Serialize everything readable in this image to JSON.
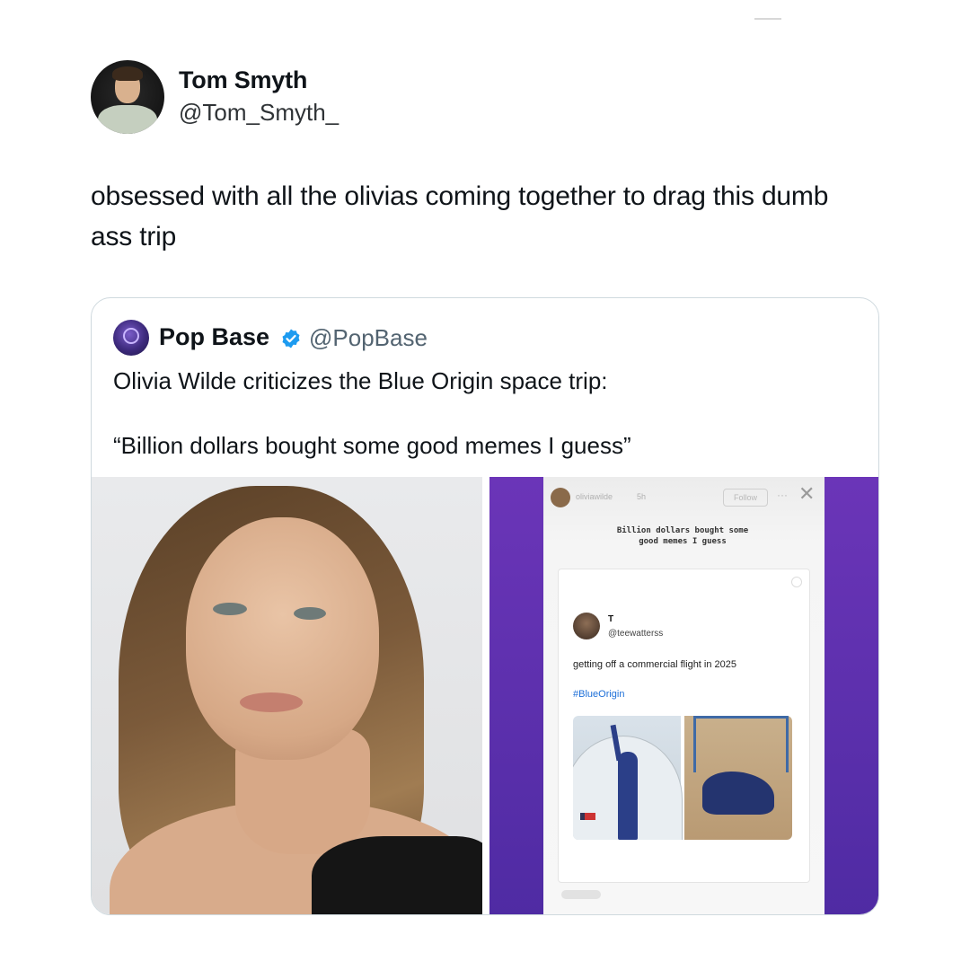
{
  "tweet": {
    "author_name": "Tom Smyth",
    "author_handle": "@Tom_Smyth_",
    "text": "obsessed with all the olivias coming together to drag this dumb ass trip"
  },
  "quote": {
    "author_name": "Pop Base",
    "author_handle": "@PopBase",
    "verified": true,
    "text": "Olivia Wilde criticizes the Blue Origin space trip:\n\n“Billion dollars bought some good memes I guess”"
  },
  "story": {
    "username": "oliviawilde",
    "time": "5h",
    "follow_label": "Follow",
    "more_icon": "···",
    "close_icon": "✕",
    "caption": "Billion dollars bought some\ngood memes I guess",
    "inner_tweet": {
      "name": "T",
      "handle": "@teewatterss",
      "text": "getting off a commercial flight in 2025",
      "hashtag": "#BlueOrigin"
    }
  },
  "colors": {
    "verified_badge": "#1d9bf0",
    "story_background": "#5b2fb0",
    "hashtag": "#1d6fd8"
  },
  "icons": [
    "verified-badge-icon",
    "close-icon",
    "more-icon",
    "search-icon"
  ]
}
